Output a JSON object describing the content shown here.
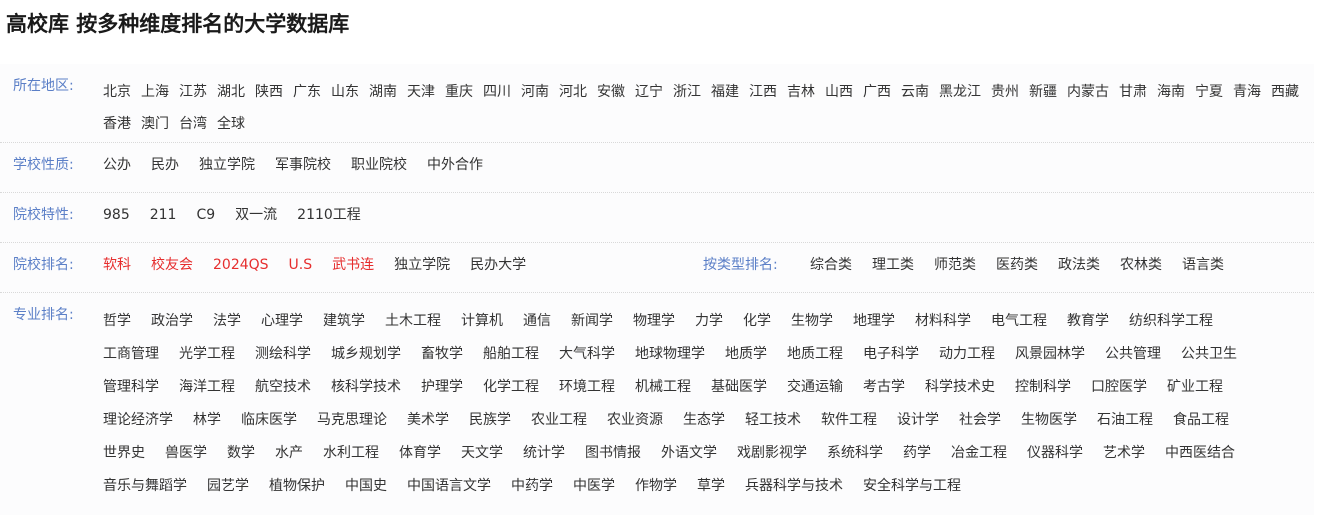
{
  "title": "高校库 按多种维度排名的大学数据库",
  "colors": {
    "label": "#5b7fc7",
    "highlight": "#e62e2e",
    "text": "#333333"
  },
  "region": {
    "label": "所在地区:",
    "items": [
      "北京",
      "上海",
      "江苏",
      "湖北",
      "陕西",
      "广东",
      "山东",
      "湖南",
      "天津",
      "重庆",
      "四川",
      "河南",
      "河北",
      "安徽",
      "辽宁",
      "浙江",
      "福建",
      "江西",
      "吉林",
      "山西",
      "广西",
      "云南",
      "黑龙江",
      "贵州",
      "新疆",
      "内蒙古",
      "甘肃",
      "海南",
      "宁夏",
      "青海",
      "西藏",
      "香港",
      "澳门",
      "台湾",
      "全球"
    ]
  },
  "nature": {
    "label": "学校性质:",
    "items": [
      "公办",
      "民办",
      "独立学院",
      "军事院校",
      "职业院校",
      "中外合作"
    ]
  },
  "feature": {
    "label": "院校特性:",
    "items": [
      "985",
      "211",
      "C9",
      "双一流",
      "2110工程"
    ]
  },
  "ranking": {
    "label": "院校排名:",
    "items": [
      {
        "text": "软科",
        "highlight": true
      },
      {
        "text": "校友会",
        "highlight": true
      },
      {
        "text": "2024QS",
        "highlight": true
      },
      {
        "text": "U.S",
        "highlight": true
      },
      {
        "text": "武书连",
        "highlight": true
      },
      {
        "text": "独立学院",
        "highlight": false
      },
      {
        "text": "民办大学",
        "highlight": false
      }
    ],
    "type_label": "按类型排名:",
    "type_items": [
      "综合类",
      "理工类",
      "师范类",
      "医药类",
      "政法类",
      "农林类",
      "语言类"
    ]
  },
  "major": {
    "label": "专业排名:",
    "items": [
      "哲学",
      "政治学",
      "法学",
      "心理学",
      "建筑学",
      "土木工程",
      "计算机",
      "通信",
      "新闻学",
      "物理学",
      "力学",
      "化学",
      "生物学",
      "地理学",
      "材料科学",
      "电气工程",
      "教育学",
      "纺织科学工程",
      "工商管理",
      "光学工程",
      "测绘科学",
      "城乡规划学",
      "畜牧学",
      "船舶工程",
      "大气科学",
      "地球物理学",
      "地质学",
      "地质工程",
      "电子科学",
      "动力工程",
      "风景园林学",
      "公共管理",
      "公共卫生",
      "管理科学",
      "海洋工程",
      "航空技术",
      "核科学技术",
      "护理学",
      "化学工程",
      "环境工程",
      "机械工程",
      "基础医学",
      "交通运输",
      "考古学",
      "科学技术史",
      "控制科学",
      "口腔医学",
      "矿业工程",
      "理论经济学",
      "林学",
      "临床医学",
      "马克思理论",
      "美术学",
      "民族学",
      "农业工程",
      "农业资源",
      "生态学",
      "轻工技术",
      "软件工程",
      "设计学",
      "社会学",
      "生物医学",
      "石油工程",
      "食品工程",
      "世界史",
      "兽医学",
      "数学",
      "水产",
      "水利工程",
      "体育学",
      "天文学",
      "统计学",
      "图书情报",
      "外语文学",
      "戏剧影视学",
      "系统科学",
      "药学",
      "冶金工程",
      "仪器科学",
      "艺术学",
      "中西医结合",
      "音乐与舞蹈学",
      "园艺学",
      "植物保护",
      "中国史",
      "中国语言文学",
      "中药学",
      "中医学",
      "作物学",
      "草学",
      "兵器科学与技术",
      "安全科学与工程"
    ]
  }
}
